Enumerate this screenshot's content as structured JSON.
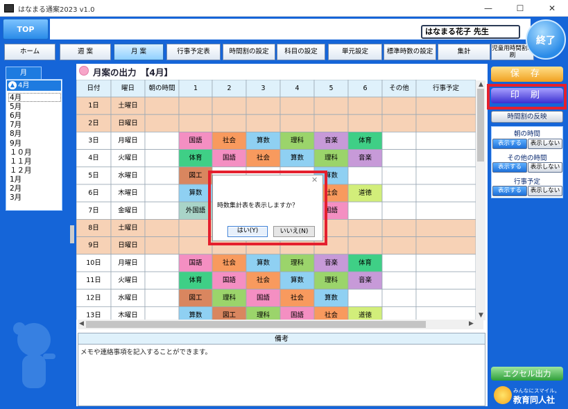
{
  "window": {
    "title": "はなまる通案2023 v1.0",
    "minimize": "—",
    "maximize": "☐",
    "close": "✕"
  },
  "top_button": "TOP",
  "user_name": "はなまる花子 先生",
  "exit_label": "終了",
  "nav": [
    {
      "label": "ホーム",
      "active": false
    },
    {
      "label": "週 案",
      "active": false
    },
    {
      "label": "月 案",
      "active": true
    },
    {
      "label": "行事予定表",
      "active": false
    },
    {
      "label": "時間割の設定",
      "active": false
    },
    {
      "label": "科目の設定",
      "active": false
    },
    {
      "label": "単元設定",
      "active": false
    },
    {
      "label": "標準時数の設定",
      "active": false
    },
    {
      "label": "集計",
      "active": false
    },
    {
      "label": "児童用時間割印刷",
      "active": false
    }
  ],
  "month_panel": {
    "tab": "月",
    "selected": "4月",
    "items": [
      "4月",
      "5月",
      "6月",
      "7月",
      "8月",
      "9月",
      "１０月",
      "１１月",
      "１２月",
      "1月",
      "2月",
      "3月"
    ]
  },
  "content_title": "月案の出力　【4月】",
  "table": {
    "headers": [
      "日付",
      "曜日",
      "朝の時間",
      "1",
      "2",
      "3",
      "4",
      "5",
      "6",
      "その他",
      "行事予定"
    ],
    "rows": [
      {
        "date": "1日",
        "day": "土曜日",
        "weekend": true,
        "cells": [
          "",
          "",
          "",
          "",
          "",
          ""
        ]
      },
      {
        "date": "2日",
        "day": "日曜日",
        "weekend": true,
        "cells": [
          "",
          "",
          "",
          "",
          "",
          ""
        ]
      },
      {
        "date": "3日",
        "day": "月曜日",
        "weekend": false,
        "cells": [
          "国語",
          "社会",
          "算数",
          "理科",
          "音楽",
          "体育"
        ]
      },
      {
        "date": "4日",
        "day": "火曜日",
        "weekend": false,
        "cells": [
          "体育",
          "国語",
          "社会",
          "算数",
          "理科",
          "音楽"
        ]
      },
      {
        "date": "5日",
        "day": "水曜日",
        "weekend": false,
        "cells": [
          "図工",
          "",
          "",
          "",
          "算数",
          ""
        ]
      },
      {
        "date": "6日",
        "day": "木曜日",
        "weekend": false,
        "cells": [
          "算数",
          "",
          "",
          "",
          "社会",
          "道徳"
        ]
      },
      {
        "date": "7日",
        "day": "金曜日",
        "weekend": false,
        "cells": [
          "外国語",
          "",
          "",
          "",
          "国語",
          ""
        ]
      },
      {
        "date": "8日",
        "day": "土曜日",
        "weekend": true,
        "cells": [
          "",
          "",
          "",
          "",
          "",
          ""
        ]
      },
      {
        "date": "9日",
        "day": "日曜日",
        "weekend": true,
        "cells": [
          "",
          "",
          "",
          "",
          "",
          ""
        ]
      },
      {
        "date": "10日",
        "day": "月曜日",
        "weekend": false,
        "cells": [
          "国語",
          "社会",
          "算数",
          "理科",
          "音楽",
          "体育"
        ]
      },
      {
        "date": "11日",
        "day": "火曜日",
        "weekend": false,
        "cells": [
          "体育",
          "国語",
          "社会",
          "算数",
          "理科",
          "音楽"
        ]
      },
      {
        "date": "12日",
        "day": "水曜日",
        "weekend": false,
        "cells": [
          "図工",
          "理科",
          "国語",
          "社会",
          "算数",
          ""
        ]
      },
      {
        "date": "13日",
        "day": "木曜日",
        "weekend": false,
        "cells": [
          "算数",
          "図工",
          "理科",
          "国語",
          "社会",
          "道徳"
        ]
      }
    ]
  },
  "subject_colors": {
    "国語": "#f48fc2",
    "社会": "#f89a5e",
    "算数": "#8fd0f2",
    "理科": "#9bd46b",
    "音楽": "#c79ad8",
    "体育": "#3fcf86",
    "図工": "#d9865f",
    "外国語": "#a9d4c8",
    "道徳": "#d2ee7a",
    "weekend": "#f7d2b6"
  },
  "memo": {
    "header": "備考",
    "text": "メモや連絡事項を記入することができます。"
  },
  "right_panel": {
    "save": "保 存",
    "print": "印 刷",
    "reflect": "時間割の反映",
    "morning_label": "朝の時間",
    "other_label": "その他の時間",
    "event_label": "行事予定",
    "show": "表示する",
    "hide": "表示しない",
    "excel": "エクセル出力",
    "logo_tag": "みんなにスマイル。",
    "logo_name": "教育同人社"
  },
  "dialog": {
    "message": "時数集計表を表示しますか？",
    "yes": "はい(Y)",
    "no": "いいえ(N)",
    "close": "✕"
  }
}
